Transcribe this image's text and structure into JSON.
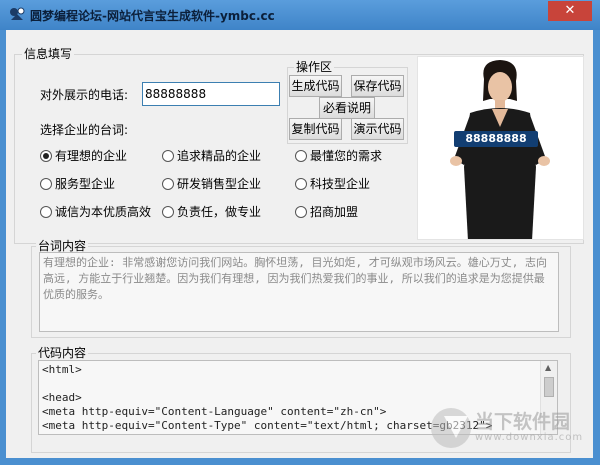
{
  "window": {
    "title": "圆梦编程论坛-网站代言宝生成软件-ymbc.cc",
    "close_glyph": "✕"
  },
  "info_group": {
    "legend": "信息填写",
    "phone_label": "对外展示的电话:",
    "phone_value": "88888888",
    "slogan_label": "选择企业的台词:"
  },
  "operations": {
    "legend": "操作区",
    "generate_label": "生成代码",
    "save_label": "保存代码",
    "help_label": "必看说明",
    "copy_label": "复制代码",
    "demo_label": "演示代码"
  },
  "slogan_options": [
    {
      "label": "有理想的企业",
      "checked": true
    },
    {
      "label": "追求精品的企业",
      "checked": false
    },
    {
      "label": "最懂您的需求",
      "checked": false
    },
    {
      "label": "服务型企业",
      "checked": false
    },
    {
      "label": "研发销售型企业",
      "checked": false
    },
    {
      "label": "科技型企业",
      "checked": false
    },
    {
      "label": "诚信为本优质高效",
      "checked": false
    },
    {
      "label": "负责任，做专业",
      "checked": false
    },
    {
      "label": "招商加盟",
      "checked": false
    }
  ],
  "preview": {
    "sign_number": "88888888"
  },
  "slogan_content": {
    "legend": "台词内容",
    "text": "有理想的企业: 非常感谢您访问我们网站。胸怀坦荡, 目光如炬, 才可纵观市场风云。雄心万丈, 志向高远, 方能立于行业翘楚。因为我们有理想, 因为我们热爱我们的事业, 所以我们的追求是为您提供最优质的服务。"
  },
  "code_content": {
    "legend": "代码内容",
    "lines": "<html>\n\n<head>\n<meta http-equiv=\"Content-Language\" content=\"zh-cn\">\n<meta http-equiv=\"Content-Type\" content=\"text/html; charset=gb2312\">"
  },
  "watermark": {
    "main": "当下软件园",
    "sub": "www.downxia.com"
  },
  "colors": {
    "titlebar": "#4a8fd0",
    "close_button": "#c8443a",
    "sign_background": "#123e72"
  }
}
